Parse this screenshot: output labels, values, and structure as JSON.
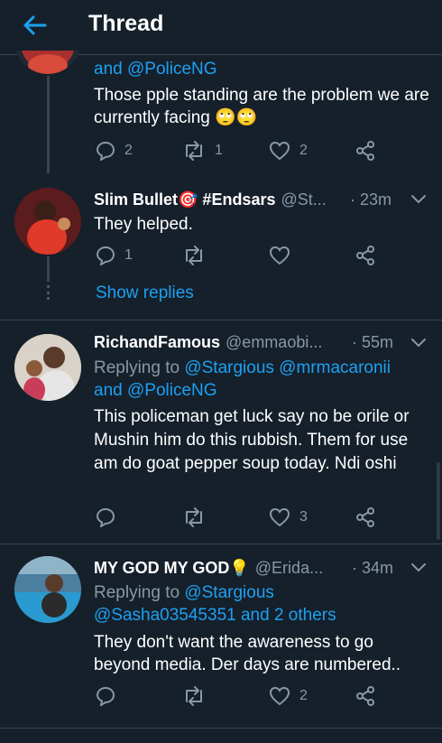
{
  "header": {
    "title": "Thread"
  },
  "tweet0": {
    "reply_line": "and @PoliceNG",
    "text": "Those pple standing are the problem we are currently facing 🙄🙄",
    "replies": "2",
    "retweets": "1",
    "likes": "2"
  },
  "tweet1": {
    "name": "Slim Bullet🎯 #Endsars",
    "handle": "@St...",
    "time": "· 23m",
    "text": "They helped.",
    "replies": "1",
    "retweets": "",
    "likes": ""
  },
  "show_replies": "Show replies",
  "tweet2": {
    "name": "RichandFamous",
    "handle": "@emmaobi...",
    "time": "· 55m",
    "replying_prefix": "Replying to ",
    "replying_to_1": "@Stargious @mrmacaronii",
    "replying_to_2": "and @PoliceNG",
    "text": "This policeman get luck say no be orile or Mushin him do this rubbish. Them for use am do goat pepper soup today. Ndi oshi",
    "replies": "",
    "retweets": "",
    "likes": "3"
  },
  "tweet3": {
    "name": "MY GOD MY GOD💡",
    "handle": "@Erida...",
    "time": "· 34m",
    "replying_prefix": "Replying to ",
    "replying_to_1": "@Stargious",
    "replying_to_2": "@Sasha03545351 and 2 others",
    "text": "They don't want the awareness to go beyond media.  Der days are numbered..",
    "replies": "",
    "retweets": "",
    "likes": "2"
  },
  "colors": {
    "background": "#15202b",
    "accent": "#1da1f2",
    "muted": "#8899a6",
    "border": "#38444d"
  }
}
